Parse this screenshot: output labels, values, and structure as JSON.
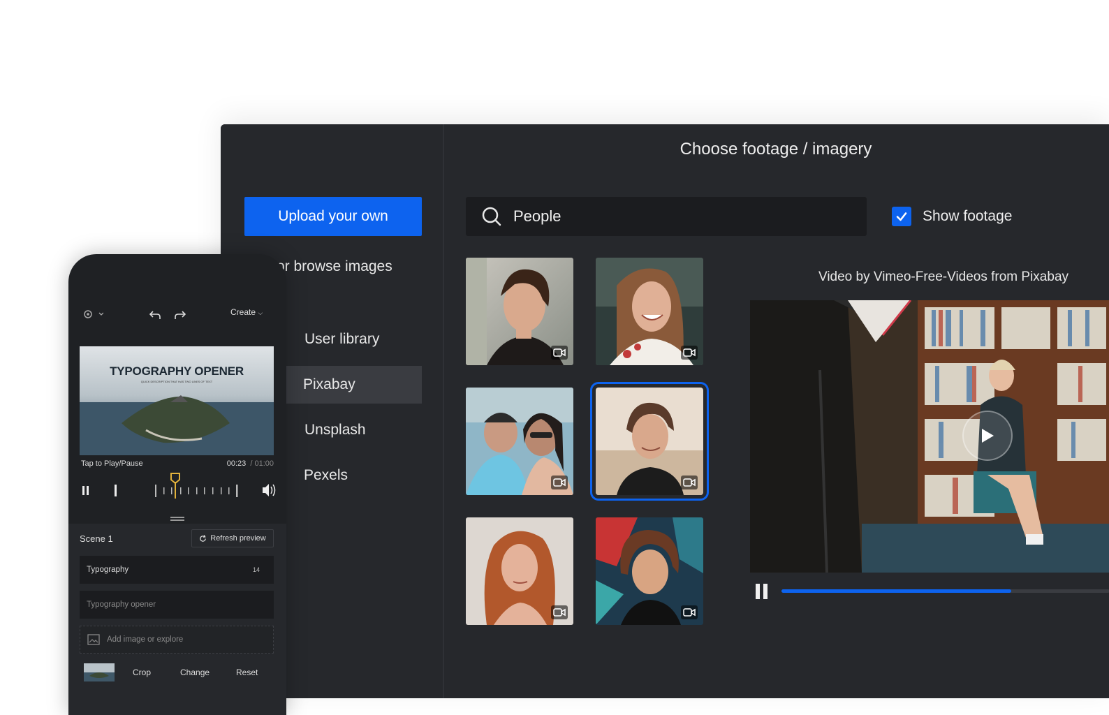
{
  "desktop": {
    "sidebar": {
      "upload_label": "Upload your own",
      "browse_label": "or browse images",
      "sources": [
        "User library",
        "Pixabay",
        "Unsplash",
        "Pexels"
      ],
      "active_source": "Pixabay"
    },
    "main": {
      "title": "Choose footage / imagery",
      "search": {
        "value": "People",
        "icon": "search-icon"
      },
      "show_footage": {
        "label": "Show footage",
        "checked": true
      },
      "results_count": 6,
      "selected_index": 3,
      "credit": "Video by Vimeo-Free-Videos from Pixabay",
      "player": {
        "progress": 0.7
      }
    },
    "accent": "#0d63ef"
  },
  "phone": {
    "toolbar": {
      "create_label": "Create"
    },
    "preview": {
      "title": "TYPOGRAPHY OPENER",
      "subtitle": "QUICK DESCRIPTION THAT HAS TWO LINES OF TEXT"
    },
    "tap_label": "Tap to Play/Pause",
    "time_current": "00:23",
    "time_total": "/ 01:00",
    "scene_label": "Scene 1",
    "refresh_label": "Refresh preview",
    "field_label": "Typography",
    "field_count": "14",
    "text_value": "Typography opener",
    "add_image_label": "Add image or explore",
    "actions": [
      "Crop",
      "Change",
      "Reset"
    ]
  }
}
